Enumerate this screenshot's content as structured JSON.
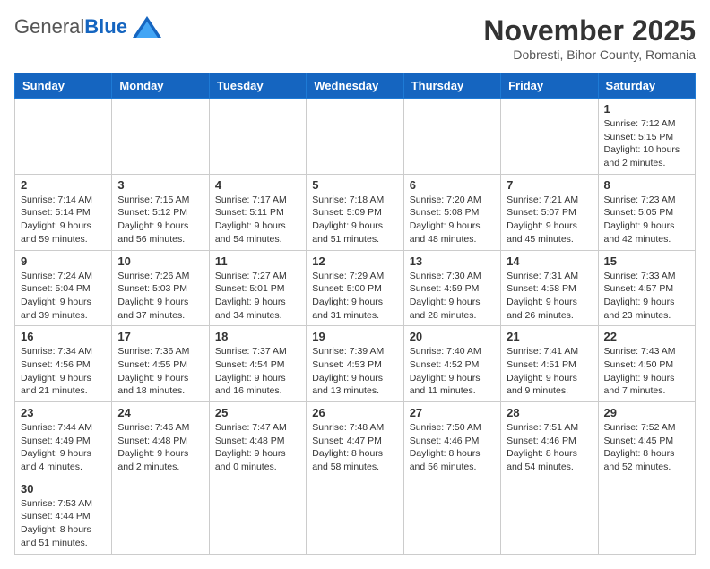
{
  "logo": {
    "general": "General",
    "blue": "Blue"
  },
  "title": "November 2025",
  "subtitle": "Dobresti, Bihor County, Romania",
  "weekdays": [
    "Sunday",
    "Monday",
    "Tuesday",
    "Wednesday",
    "Thursday",
    "Friday",
    "Saturday"
  ],
  "weeks": [
    [
      {
        "day": "",
        "info": ""
      },
      {
        "day": "",
        "info": ""
      },
      {
        "day": "",
        "info": ""
      },
      {
        "day": "",
        "info": ""
      },
      {
        "day": "",
        "info": ""
      },
      {
        "day": "",
        "info": ""
      },
      {
        "day": "1",
        "info": "Sunrise: 7:12 AM\nSunset: 5:15 PM\nDaylight: 10 hours and 2 minutes."
      }
    ],
    [
      {
        "day": "2",
        "info": "Sunrise: 7:14 AM\nSunset: 5:14 PM\nDaylight: 9 hours and 59 minutes."
      },
      {
        "day": "3",
        "info": "Sunrise: 7:15 AM\nSunset: 5:12 PM\nDaylight: 9 hours and 56 minutes."
      },
      {
        "day": "4",
        "info": "Sunrise: 7:17 AM\nSunset: 5:11 PM\nDaylight: 9 hours and 54 minutes."
      },
      {
        "day": "5",
        "info": "Sunrise: 7:18 AM\nSunset: 5:09 PM\nDaylight: 9 hours and 51 minutes."
      },
      {
        "day": "6",
        "info": "Sunrise: 7:20 AM\nSunset: 5:08 PM\nDaylight: 9 hours and 48 minutes."
      },
      {
        "day": "7",
        "info": "Sunrise: 7:21 AM\nSunset: 5:07 PM\nDaylight: 9 hours and 45 minutes."
      },
      {
        "day": "8",
        "info": "Sunrise: 7:23 AM\nSunset: 5:05 PM\nDaylight: 9 hours and 42 minutes."
      }
    ],
    [
      {
        "day": "9",
        "info": "Sunrise: 7:24 AM\nSunset: 5:04 PM\nDaylight: 9 hours and 39 minutes."
      },
      {
        "day": "10",
        "info": "Sunrise: 7:26 AM\nSunset: 5:03 PM\nDaylight: 9 hours and 37 minutes."
      },
      {
        "day": "11",
        "info": "Sunrise: 7:27 AM\nSunset: 5:01 PM\nDaylight: 9 hours and 34 minutes."
      },
      {
        "day": "12",
        "info": "Sunrise: 7:29 AM\nSunset: 5:00 PM\nDaylight: 9 hours and 31 minutes."
      },
      {
        "day": "13",
        "info": "Sunrise: 7:30 AM\nSunset: 4:59 PM\nDaylight: 9 hours and 28 minutes."
      },
      {
        "day": "14",
        "info": "Sunrise: 7:31 AM\nSunset: 4:58 PM\nDaylight: 9 hours and 26 minutes."
      },
      {
        "day": "15",
        "info": "Sunrise: 7:33 AM\nSunset: 4:57 PM\nDaylight: 9 hours and 23 minutes."
      }
    ],
    [
      {
        "day": "16",
        "info": "Sunrise: 7:34 AM\nSunset: 4:56 PM\nDaylight: 9 hours and 21 minutes."
      },
      {
        "day": "17",
        "info": "Sunrise: 7:36 AM\nSunset: 4:55 PM\nDaylight: 9 hours and 18 minutes."
      },
      {
        "day": "18",
        "info": "Sunrise: 7:37 AM\nSunset: 4:54 PM\nDaylight: 9 hours and 16 minutes."
      },
      {
        "day": "19",
        "info": "Sunrise: 7:39 AM\nSunset: 4:53 PM\nDaylight: 9 hours and 13 minutes."
      },
      {
        "day": "20",
        "info": "Sunrise: 7:40 AM\nSunset: 4:52 PM\nDaylight: 9 hours and 11 minutes."
      },
      {
        "day": "21",
        "info": "Sunrise: 7:41 AM\nSunset: 4:51 PM\nDaylight: 9 hours and 9 minutes."
      },
      {
        "day": "22",
        "info": "Sunrise: 7:43 AM\nSunset: 4:50 PM\nDaylight: 9 hours and 7 minutes."
      }
    ],
    [
      {
        "day": "23",
        "info": "Sunrise: 7:44 AM\nSunset: 4:49 PM\nDaylight: 9 hours and 4 minutes."
      },
      {
        "day": "24",
        "info": "Sunrise: 7:46 AM\nSunset: 4:48 PM\nDaylight: 9 hours and 2 minutes."
      },
      {
        "day": "25",
        "info": "Sunrise: 7:47 AM\nSunset: 4:48 PM\nDaylight: 9 hours and 0 minutes."
      },
      {
        "day": "26",
        "info": "Sunrise: 7:48 AM\nSunset: 4:47 PM\nDaylight: 8 hours and 58 minutes."
      },
      {
        "day": "27",
        "info": "Sunrise: 7:50 AM\nSunset: 4:46 PM\nDaylight: 8 hours and 56 minutes."
      },
      {
        "day": "28",
        "info": "Sunrise: 7:51 AM\nSunset: 4:46 PM\nDaylight: 8 hours and 54 minutes."
      },
      {
        "day": "29",
        "info": "Sunrise: 7:52 AM\nSunset: 4:45 PM\nDaylight: 8 hours and 52 minutes."
      }
    ],
    [
      {
        "day": "30",
        "info": "Sunrise: 7:53 AM\nSunset: 4:44 PM\nDaylight: 8 hours and 51 minutes."
      },
      {
        "day": "",
        "info": ""
      },
      {
        "day": "",
        "info": ""
      },
      {
        "day": "",
        "info": ""
      },
      {
        "day": "",
        "info": ""
      },
      {
        "day": "",
        "info": ""
      },
      {
        "day": "",
        "info": ""
      }
    ]
  ]
}
